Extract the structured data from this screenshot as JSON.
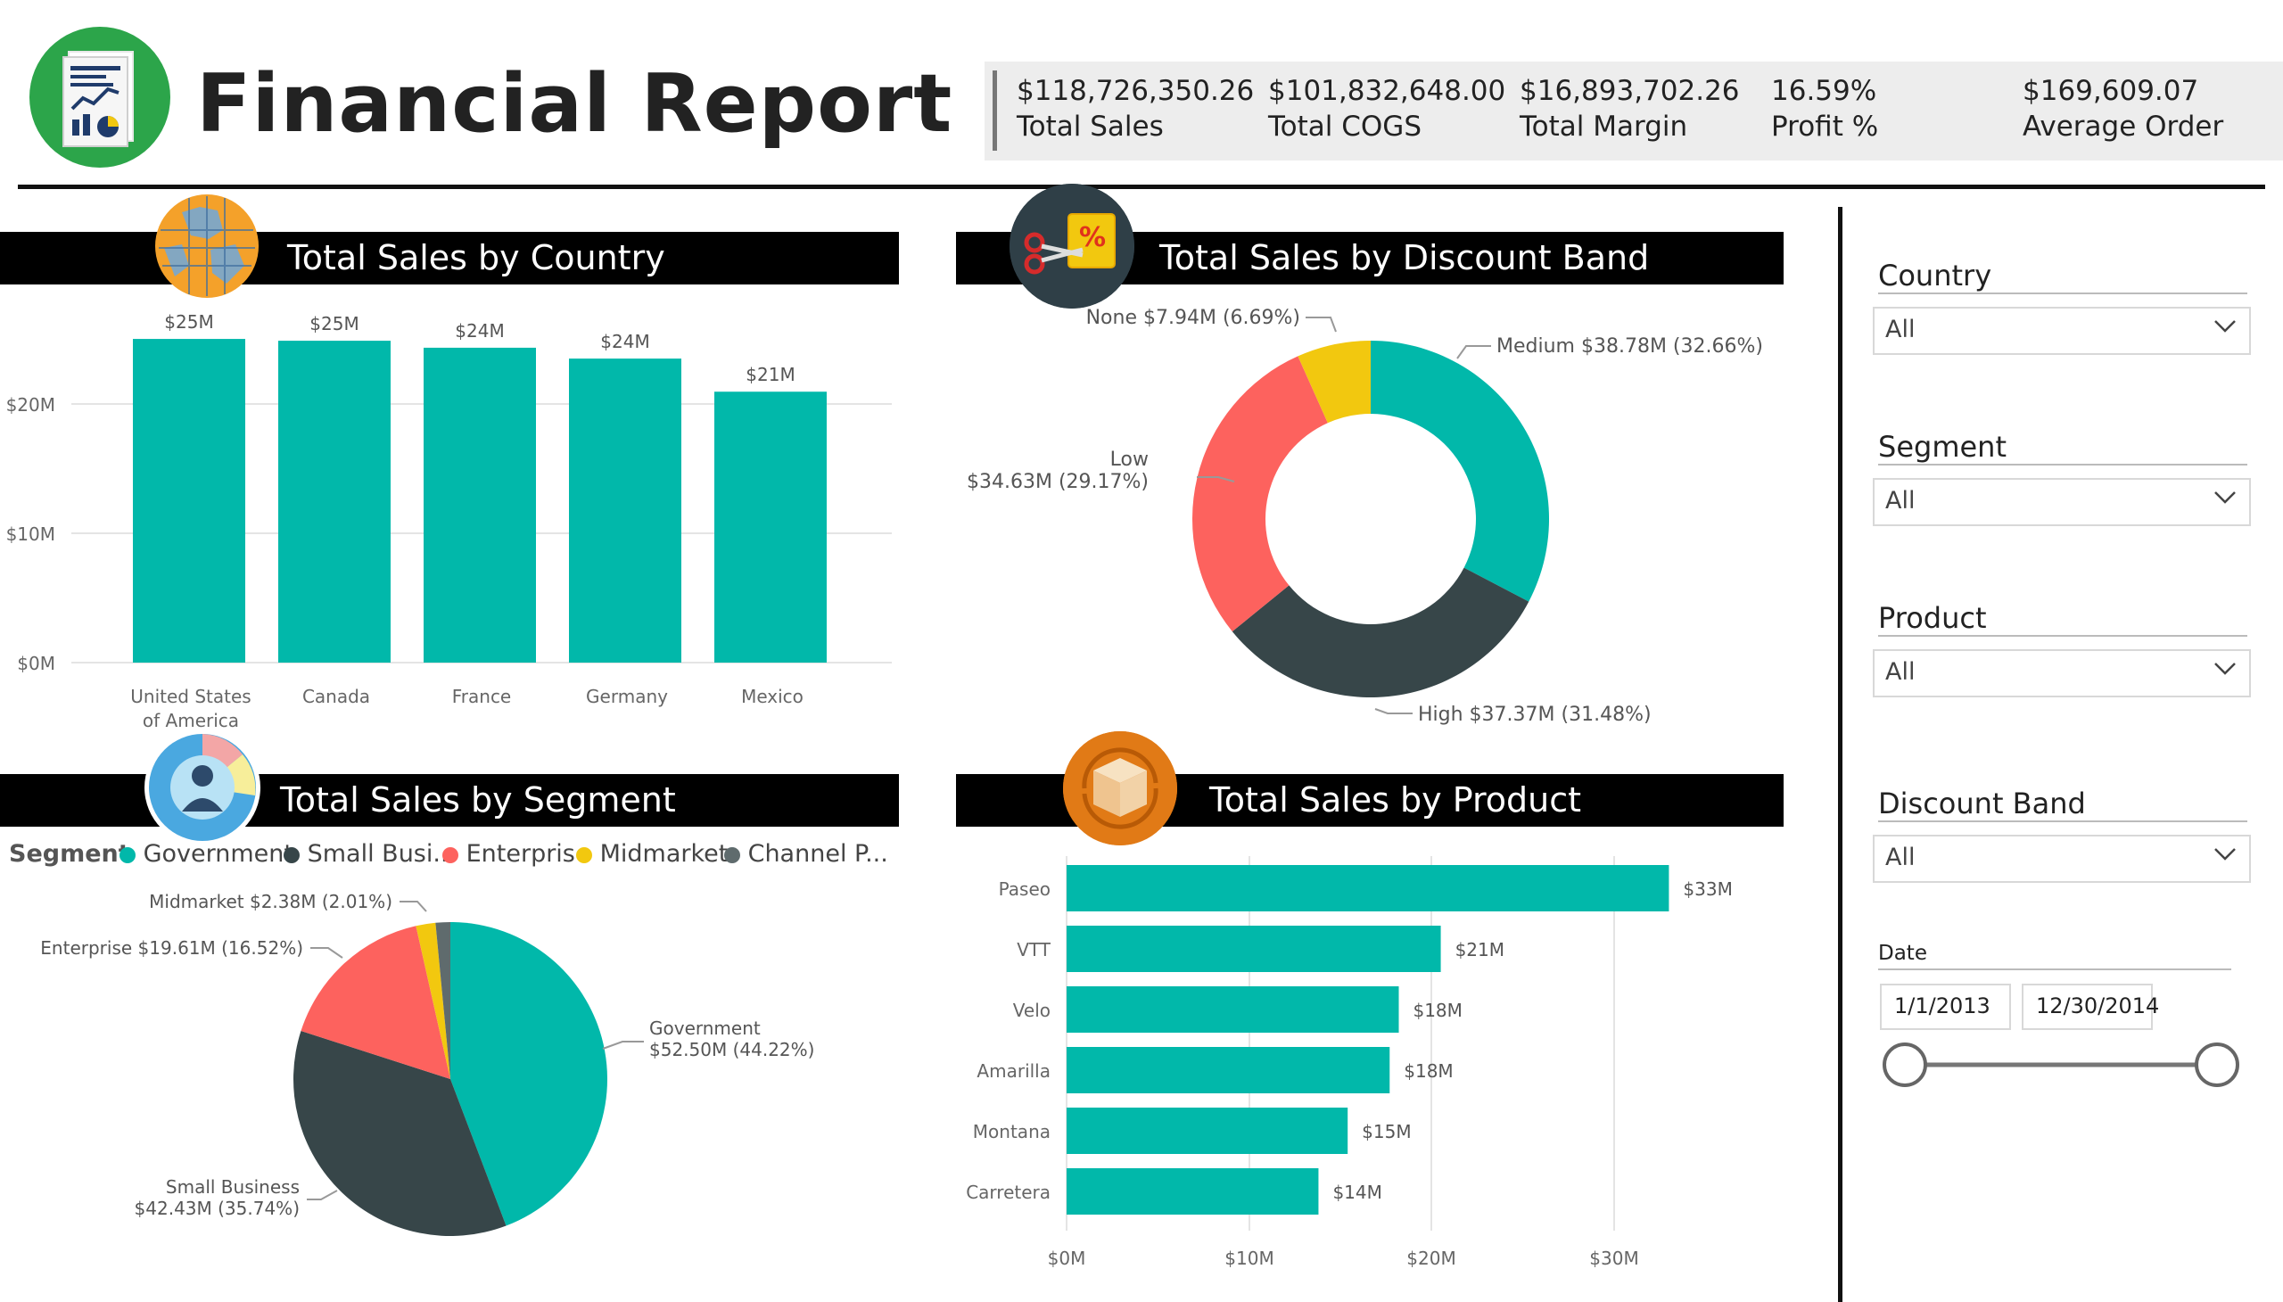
{
  "title": "Financial Report",
  "kpis": [
    {
      "value": "$118,726,350.26",
      "label": "Total Sales"
    },
    {
      "value": "$101,832,648.00",
      "label": "Total COGS"
    },
    {
      "value": "$16,893,702.26",
      "label": "Total Margin"
    },
    {
      "value": "16.59%",
      "label": "Profit %"
    },
    {
      "value": "$169,609.07",
      "label": "Average Order"
    }
  ],
  "icons": {
    "logo": "report-document-icon",
    "country": "globe-icon",
    "discount": "discount-tag-icon",
    "segment": "pie-person-icon",
    "product": "package-box-icon"
  },
  "colors": {
    "teal": "#01b8aa",
    "dark": "#374649",
    "red": "#fd625e",
    "yellow": "#f2c80f",
    "gray": "#5f6b6d",
    "logo_green": "#2ca54a"
  },
  "panels": {
    "country_title": "Total Sales by Country",
    "discount_title": "Total Sales by Discount Band",
    "segment_title": "Total Sales by Segment",
    "product_title": "Total Sales by Product"
  },
  "segment_legend": {
    "title": "Segment",
    "items": [
      {
        "label": "Government",
        "color": "#01b8aa"
      },
      {
        "label": "Small Busi...",
        "color": "#374649"
      },
      {
        "label": "Enterprise",
        "color": "#fd625e"
      },
      {
        "label": "Midmarket",
        "color": "#f2c80f"
      },
      {
        "label": "Channel P...",
        "color": "#5f6b6d"
      }
    ]
  },
  "slicers": {
    "country": {
      "title": "Country",
      "value": "All"
    },
    "segment": {
      "title": "Segment",
      "value": "All"
    },
    "product": {
      "title": "Product",
      "value": "All"
    },
    "discount": {
      "title": "Discount Band",
      "value": "All"
    },
    "date": {
      "title": "Date",
      "start": "1/1/2013",
      "end": "12/30/2014",
      "range": [
        0,
        1
      ]
    }
  },
  "chart_data": [
    {
      "type": "bar",
      "title": "Total Sales by Country",
      "categories": [
        "United States of America",
        "Canada",
        "France",
        "Germany",
        "Mexico"
      ],
      "values": [
        25.03,
        24.89,
        24.35,
        23.51,
        20.95
      ],
      "data_labels": [
        "$25M",
        "$25M",
        "$24M",
        "$24M",
        "$21M"
      ],
      "y_ticks": [
        {
          "v": 0,
          "label": "$0M"
        },
        {
          "v": 10,
          "label": "$10M"
        },
        {
          "v": 20,
          "label": "$20M"
        }
      ],
      "ylim": [
        0,
        28
      ],
      "color": "#01b8aa",
      "grid": true
    },
    {
      "type": "pie",
      "title": "Total Sales by Discount Band",
      "donut": true,
      "slices": [
        {
          "name": "Medium",
          "value": 32.66,
          "color": "#01b8aa",
          "label": "Medium $38.78M (32.66%)"
        },
        {
          "name": "High",
          "value": 31.48,
          "color": "#374649",
          "label": "High $37.37M (31.48%)"
        },
        {
          "name": "Low",
          "value": 29.17,
          "color": "#fd625e",
          "label_line1": "Low",
          "label_line2": "$34.63M (29.17%)"
        },
        {
          "name": "None",
          "value": 6.69,
          "color": "#f2c80f",
          "label": "None $7.94M (6.69%)"
        }
      ]
    },
    {
      "type": "pie",
      "title": "Total Sales by Segment",
      "slices": [
        {
          "name": "Government",
          "value": 44.22,
          "color": "#01b8aa",
          "label_line1": "Government",
          "label_line2": "$52.50M (44.22%)"
        },
        {
          "name": "Small Business",
          "value": 35.74,
          "color": "#374649",
          "label_line1": "Small Business",
          "label_line2": "$42.43M (35.74%)"
        },
        {
          "name": "Enterprise",
          "value": 16.52,
          "color": "#fd625e",
          "label": "Enterprise $19.61M (16.52%)"
        },
        {
          "name": "Midmarket",
          "value": 2.01,
          "color": "#f2c80f",
          "label": "Midmarket $2.38M (2.01%)"
        },
        {
          "name": "Channel Partners",
          "value": 1.51,
          "color": "#5f6b6d"
        }
      ]
    },
    {
      "type": "bar",
      "orientation": "horizontal",
      "title": "Total Sales by Product",
      "categories": [
        "Paseo",
        "VTT",
        "Velo",
        "Amarilla",
        "Montana",
        "Carretera"
      ],
      "values": [
        33.0,
        20.5,
        18.2,
        17.7,
        15.4,
        13.8
      ],
      "data_labels": [
        "$33M",
        "$21M",
        "$18M",
        "$18M",
        "$15M",
        "$14M"
      ],
      "x_ticks": [
        {
          "v": 0,
          "label": "$0M"
        },
        {
          "v": 10,
          "label": "$10M"
        },
        {
          "v": 20,
          "label": "$20M"
        },
        {
          "v": 30,
          "label": "$30M"
        }
      ],
      "xlim": [
        0,
        33
      ],
      "color": "#01b8aa",
      "grid": true
    }
  ]
}
